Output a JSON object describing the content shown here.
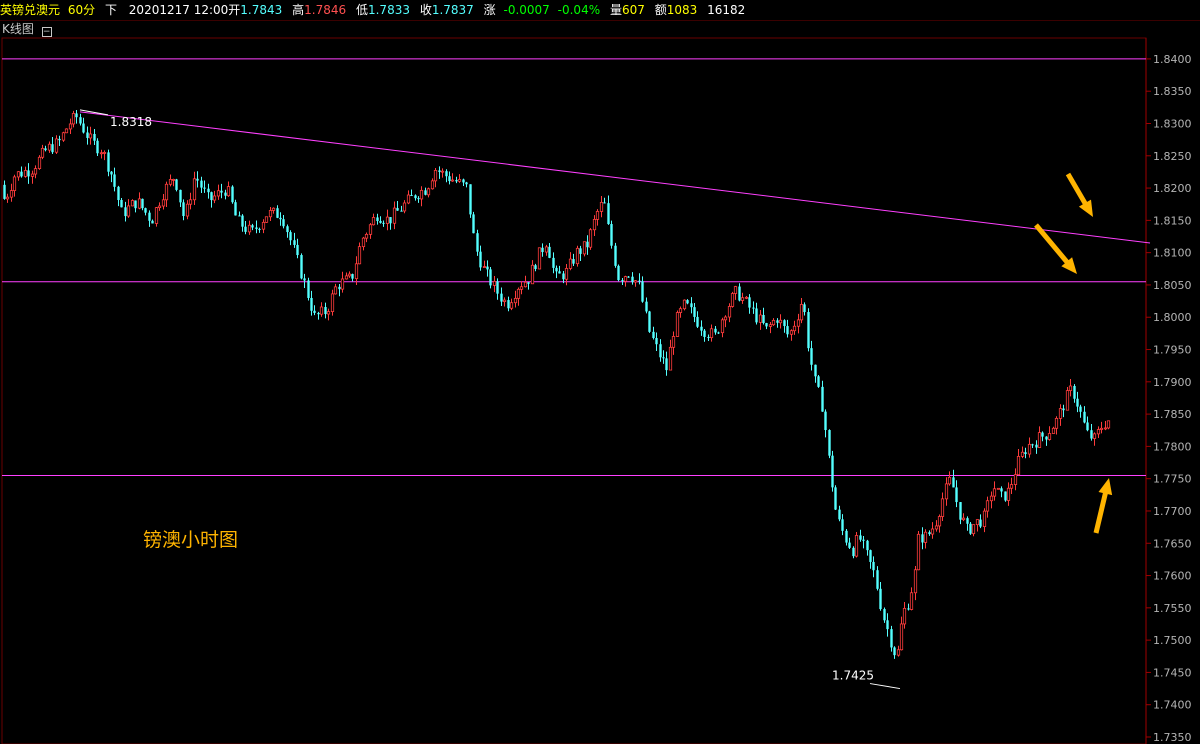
{
  "header": {
    "symbol": "英镑兑澳元",
    "period": "60分",
    "cursor_mode": "下",
    "datetime": "20201217 12:00",
    "open_label": "开",
    "open": "1.7843",
    "high_label": "高",
    "high": "1.7846",
    "low_label": "低",
    "low": "1.7833",
    "close_label": "收",
    "close": "1.7837",
    "change_label": "涨",
    "change": "-0.0007",
    "change_pct": "-0.04%",
    "volume_label": "量",
    "volume": "607",
    "amount_label": "额",
    "amount": "1083",
    "extra": "16182"
  },
  "chart_title": "K线图",
  "colors": {
    "up": "#ff3c3c",
    "down": "#54ffff",
    "line": "#ff40ff",
    "axis": "#a00000",
    "tick_text": "#b4b4b4",
    "annotation": "#ffb400",
    "white": "#ffffff"
  },
  "chart_data": {
    "type": "candlestick",
    "ylim": [
      1.735,
      1.842
    ],
    "yticks": [
      "1.8400",
      "1.8350",
      "1.8300",
      "1.8250",
      "1.8200",
      "1.8150",
      "1.8100",
      "1.8050",
      "1.8000",
      "1.7950",
      "1.7900",
      "1.7850",
      "1.7800",
      "1.7750",
      "1.7700",
      "1.7650",
      "1.7600",
      "1.7550",
      "1.7500",
      "1.7450",
      "1.7400",
      "1.7350"
    ],
    "price_path": [
      [
        0,
        1.823
      ],
      [
        8,
        1.818
      ],
      [
        18,
        1.822
      ],
      [
        35,
        1.823
      ],
      [
        50,
        1.826
      ],
      [
        62,
        1.827
      ],
      [
        72,
        1.83
      ],
      [
        80,
        1.831
      ],
      [
        95,
        1.827
      ],
      [
        105,
        1.826
      ],
      [
        115,
        1.822
      ],
      [
        125,
        1.816
      ],
      [
        140,
        1.818
      ],
      [
        155,
        1.815
      ],
      [
        165,
        1.819
      ],
      [
        178,
        1.822
      ],
      [
        188,
        1.815
      ],
      [
        198,
        1.822
      ],
      [
        212,
        1.818
      ],
      [
        230,
        1.82
      ],
      [
        240,
        1.815
      ],
      [
        255,
        1.813
      ],
      [
        270,
        1.816
      ],
      [
        285,
        1.816
      ],
      [
        298,
        1.81
      ],
      [
        308,
        1.805
      ],
      [
        318,
        1.8
      ],
      [
        330,
        1.801
      ],
      [
        340,
        1.805
      ],
      [
        355,
        1.806
      ],
      [
        365,
        1.812
      ],
      [
        380,
        1.816
      ],
      [
        392,
        1.815
      ],
      [
        405,
        1.817
      ],
      [
        418,
        1.819
      ],
      [
        430,
        1.82
      ],
      [
        438,
        1.823
      ],
      [
        448,
        1.822
      ],
      [
        460,
        1.821
      ],
      [
        470,
        1.82
      ],
      [
        478,
        1.811
      ],
      [
        488,
        1.807
      ],
      [
        500,
        1.804
      ],
      [
        510,
        1.802
      ],
      [
        522,
        1.805
      ],
      [
        532,
        1.806
      ],
      [
        540,
        1.809
      ],
      [
        550,
        1.812
      ],
      [
        558,
        1.806
      ],
      [
        570,
        1.807
      ],
      [
        580,
        1.81
      ],
      [
        590,
        1.811
      ],
      [
        600,
        1.816
      ],
      [
        607,
        1.818
      ],
      [
        612,
        1.813
      ],
      [
        622,
        1.806
      ],
      [
        632,
        1.807
      ],
      [
        642,
        1.805
      ],
      [
        652,
        1.798
      ],
      [
        660,
        1.795
      ],
      [
        670,
        1.792
      ],
      [
        678,
        1.799
      ],
      [
        688,
        1.802
      ],
      [
        698,
        1.8
      ],
      [
        708,
        1.798
      ],
      [
        718,
        1.797
      ],
      [
        728,
        1.801
      ],
      [
        740,
        1.804
      ],
      [
        750,
        1.802
      ],
      [
        760,
        1.8
      ],
      [
        770,
        1.798
      ],
      [
        780,
        1.8
      ],
      [
        792,
        1.797
      ],
      [
        800,
        1.8
      ],
      [
        806,
        1.803
      ],
      [
        812,
        1.795
      ],
      [
        818,
        1.79
      ],
      [
        826,
        1.786
      ],
      [
        832,
        1.778
      ],
      [
        840,
        1.769
      ],
      [
        848,
        1.766
      ],
      [
        856,
        1.764
      ],
      [
        862,
        1.766
      ],
      [
        870,
        1.763
      ],
      [
        878,
        1.76
      ],
      [
        886,
        1.754
      ],
      [
        894,
        1.75
      ],
      [
        900,
        1.747
      ],
      [
        906,
        1.754
      ],
      [
        912,
        1.756
      ],
      [
        918,
        1.76
      ],
      [
        922,
        1.766
      ],
      [
        930,
        1.766
      ],
      [
        938,
        1.768
      ],
      [
        946,
        1.772
      ],
      [
        954,
        1.775
      ],
      [
        962,
        1.77
      ],
      [
        970,
        1.767
      ],
      [
        978,
        1.768
      ],
      [
        988,
        1.769
      ],
      [
        996,
        1.774
      ],
      [
        1004,
        1.772
      ],
      [
        1012,
        1.773
      ],
      [
        1020,
        1.777
      ],
      [
        1030,
        1.78
      ],
      [
        1040,
        1.781
      ],
      [
        1050,
        1.782
      ],
      [
        1060,
        1.784
      ],
      [
        1068,
        1.787
      ],
      [
        1075,
        1.789
      ],
      [
        1082,
        1.786
      ],
      [
        1090,
        1.782
      ],
      [
        1098,
        1.781
      ],
      [
        1104,
        1.783
      ],
      [
        1110,
        1.784
      ]
    ],
    "trendline": {
      "from": [
        80,
        1.8318
      ],
      "to": [
        1150,
        1.8115
      ]
    },
    "horizontal_levels": [
      1.84,
      1.8055,
      1.7755
    ],
    "labels": [
      {
        "text": "1.8318",
        "x": 80,
        "price": 1.8318
      },
      {
        "text": "1.7425",
        "x": 900,
        "price": 1.7425
      }
    ],
    "annotation_text": "镑澳小时图"
  }
}
